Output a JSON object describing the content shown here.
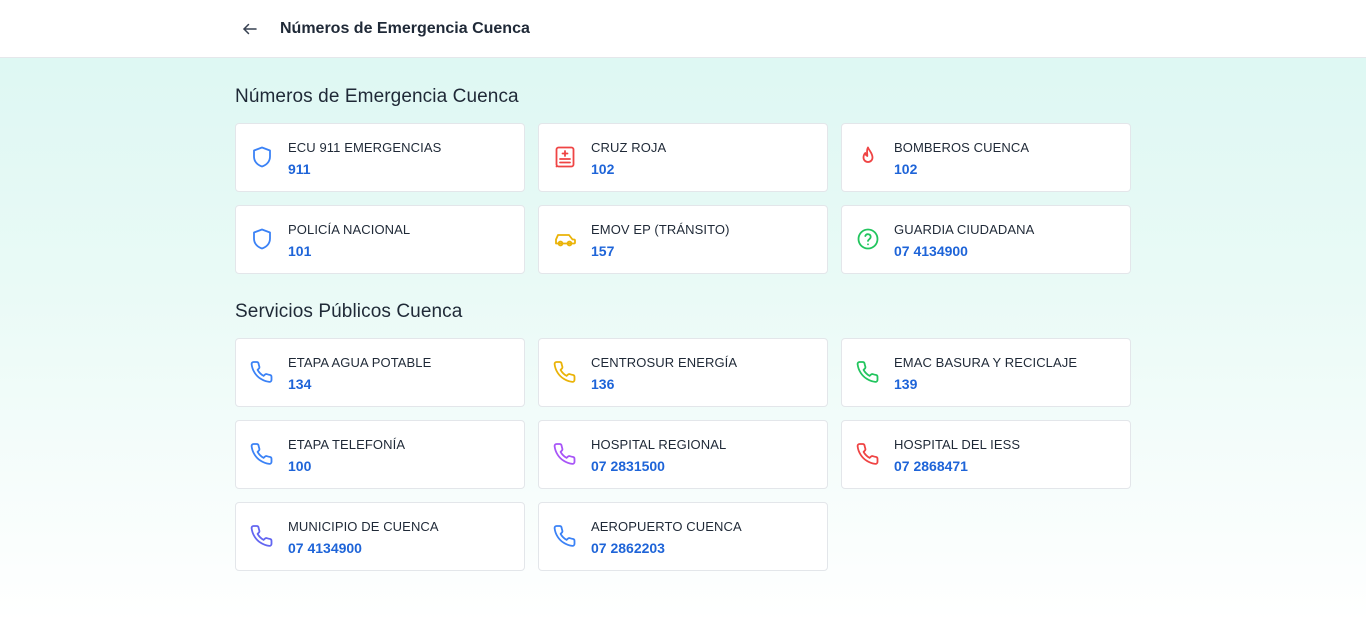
{
  "header": {
    "title": "Números de Emergencia Cuenca"
  },
  "sections": [
    {
      "title": "Números de Emergencia Cuenca",
      "items": [
        {
          "name": "ECU 911 EMERGENCIAS",
          "number": "911",
          "icon": "shield-icon",
          "color": "#3b82f6"
        },
        {
          "name": "CRUZ ROJA",
          "number": "102",
          "icon": "hospital-icon",
          "color": "#ef4444"
        },
        {
          "name": "BOMBEROS CUENCA",
          "number": "102",
          "icon": "flame-icon",
          "color": "#ef4444"
        },
        {
          "name": "POLICÍA NACIONAL",
          "number": "101",
          "icon": "shield-icon",
          "color": "#3b82f6"
        },
        {
          "name": "EMOV EP (TRÁNSITO)",
          "number": "157",
          "icon": "car-icon",
          "color": "#eab308"
        },
        {
          "name": "GUARDIA CIUDADANA",
          "number": "07 4134900",
          "icon": "help-circle-icon",
          "color": "#22c55e"
        }
      ]
    },
    {
      "title": "Servicios Públicos Cuenca",
      "items": [
        {
          "name": "ETAPA AGUA POTABLE",
          "number": "134",
          "icon": "phone-icon",
          "color": "#3b82f6"
        },
        {
          "name": "CENTROSUR ENERGÍA",
          "number": "136",
          "icon": "phone-icon",
          "color": "#eab308"
        },
        {
          "name": "EMAC BASURA Y RECICLAJE",
          "number": "139",
          "icon": "phone-icon",
          "color": "#22c55e"
        },
        {
          "name": "ETAPA TELEFONÍA",
          "number": "100",
          "icon": "phone-icon",
          "color": "#3b82f6"
        },
        {
          "name": "HOSPITAL REGIONAL",
          "number": "07 2831500",
          "icon": "phone-icon",
          "color": "#a855f7"
        },
        {
          "name": "HOSPITAL DEL IESS",
          "number": "07 2868471",
          "icon": "phone-icon",
          "color": "#ef4444"
        },
        {
          "name": "MUNICIPIO DE CUENCA",
          "number": "07 4134900",
          "icon": "phone-icon",
          "color": "#6366f1"
        },
        {
          "name": "AEROPUERTO CUENCA",
          "number": "07 2862203",
          "icon": "phone-icon",
          "color": "#3b82f6"
        }
      ]
    }
  ]
}
